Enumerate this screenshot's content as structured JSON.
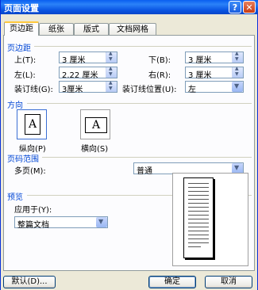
{
  "window": {
    "title": "页面设置",
    "help_label": "?",
    "close_label": "✕"
  },
  "tabs": [
    {
      "label": "页边距",
      "active": true
    },
    {
      "label": "纸张",
      "active": false
    },
    {
      "label": "版式",
      "active": false
    },
    {
      "label": "文档网格",
      "active": false
    }
  ],
  "margins": {
    "section_label": "页边距",
    "top_label": "上(T):",
    "top_value": "3 厘米",
    "bottom_label": "下(B):",
    "bottom_value": "3 厘米",
    "left_label": "左(L):",
    "left_value": "2.22 厘米",
    "right_label": "右(R):",
    "right_value": "3 厘米",
    "gutter_label": "装订线(G):",
    "gutter_value": "3厘米",
    "gutter_pos_label": "装订线位置(U):",
    "gutter_pos_value": "左"
  },
  "orientation": {
    "section_label": "方向",
    "portrait_label": "纵向(P)",
    "landscape_label": "横向(S)",
    "icon_letter": "A",
    "selected": "portrait"
  },
  "page_range": {
    "section_label": "页码范围",
    "multiple_pages_label": "多页(M):",
    "multiple_pages_value": "普通"
  },
  "preview": {
    "section_label": "预览",
    "apply_to_label": "应用于(Y):",
    "apply_to_value": "整篇文档"
  },
  "buttons": {
    "default_label": "默认(D)...",
    "ok_label": "确定",
    "cancel_label": "取消"
  },
  "colors": {
    "titlebar": "#0a5ff0",
    "section_text": "#0046d5",
    "dialog_bg": "#ece9d8"
  }
}
